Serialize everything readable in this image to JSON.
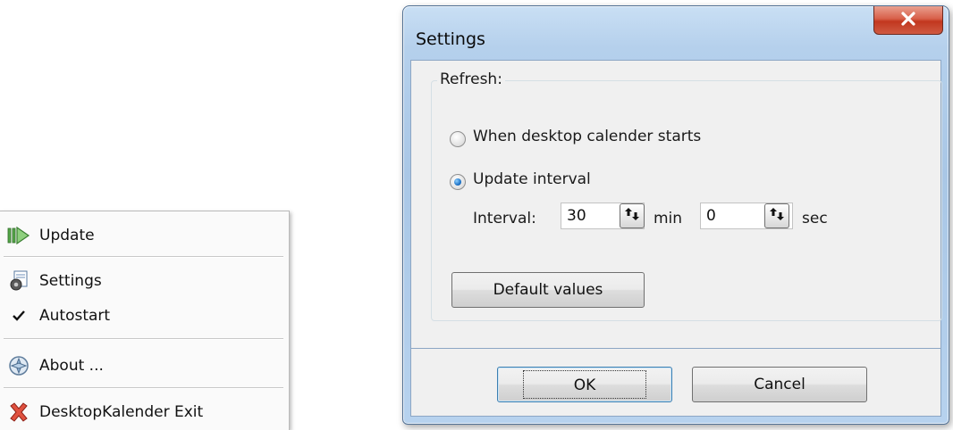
{
  "context_menu": {
    "items": [
      {
        "label": "Update",
        "icon": "update-arrow-icon"
      },
      {
        "label": "Settings",
        "icon": "settings-gear-icon"
      },
      {
        "label": "Autostart",
        "icon": "checkmark-icon",
        "checked": true
      },
      {
        "label": "About ...",
        "icon": "about-info-icon"
      },
      {
        "label": "DesktopKalender Exit",
        "icon": "exit-x-icon"
      }
    ]
  },
  "dialog": {
    "title": "Settings",
    "close_icon": "close-x-icon",
    "group_label": "Refresh:",
    "options": [
      {
        "label": "When desktop calender starts",
        "selected": false
      },
      {
        "label": "Update interval",
        "selected": true
      }
    ],
    "interval": {
      "label": "Interval:",
      "minutes_value": "30",
      "minutes_unit": "min",
      "seconds_value": "0",
      "seconds_unit": "sec"
    },
    "default_button": "Default values",
    "ok_button": "OK",
    "cancel_button": "Cancel"
  },
  "colors": {
    "titlebar": "#b5d0ec",
    "close_button": "#c2371f",
    "client": "#f0f0f0",
    "radio_selected": "#1f74c8"
  }
}
